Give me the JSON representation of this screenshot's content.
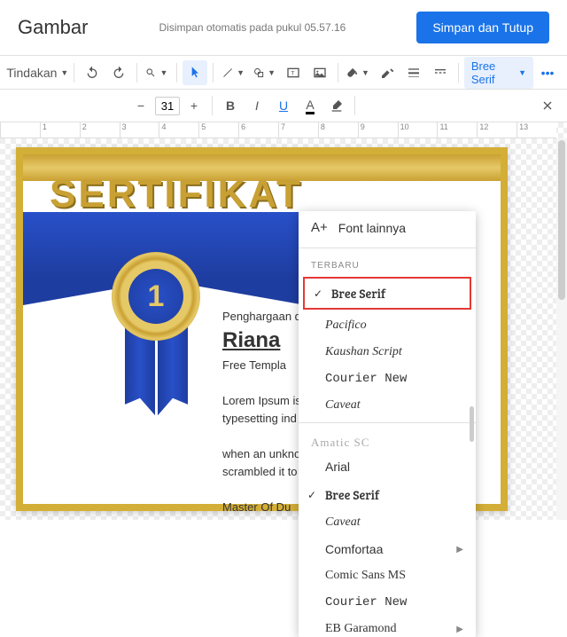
{
  "header": {
    "title": "Gambar",
    "status": "Disimpan otomatis pada pukul 05.57.16",
    "save_button": "Simpan dan Tutup"
  },
  "toolbar": {
    "actions_label": "Tindakan",
    "font_dropdown": "Bree Serif",
    "font_size": "31",
    "bold": "B",
    "italic": "I",
    "underline": "U",
    "text_color": "A"
  },
  "ruler": [
    "",
    "1",
    "2",
    "3",
    "4",
    "5",
    "6",
    "7",
    "8",
    "9",
    "10",
    "11",
    "12",
    "13"
  ],
  "doc": {
    "title": "SERTIFIKAT",
    "medal_number": "1",
    "award_label": "Penghargaan dibe",
    "name": "Riana",
    "subtitle": "Free Templa",
    "lorem1": "Lorem Ipsum is",
    "lorem2": "typesetting ind",
    "lorem3": "when an unkno",
    "lorem4": "scrambled it to",
    "master": "Master Of Du"
  },
  "font_menu": {
    "more_fonts": "Font lainnya",
    "recent_label": "TERBARU",
    "recent": [
      {
        "label": "Bree Serif",
        "family": "'Bree Serif',serif",
        "checked": true,
        "highlight": true
      },
      {
        "label": "Pacifico",
        "family": "cursive",
        "italic": true
      },
      {
        "label": "Kaushan Script",
        "family": "cursive",
        "italic": true
      },
      {
        "label": "Courier New",
        "family": "'Courier New',monospace"
      },
      {
        "label": "Caveat",
        "family": "cursive",
        "italic": true
      }
    ],
    "section2": "Amatic SC",
    "list": [
      {
        "label": "Arial",
        "family": "Arial,sans-serif"
      },
      {
        "label": "Bree Serif",
        "family": "'Bree Serif',serif",
        "checked": true
      },
      {
        "label": "Caveat",
        "family": "cursive",
        "italic": true
      },
      {
        "label": "Comfortaa",
        "family": "sans-serif",
        "arrow": true
      },
      {
        "label": "Comic Sans MS",
        "family": "'Comic Sans MS',cursive"
      },
      {
        "label": "Courier New",
        "family": "'Courier New',monospace"
      },
      {
        "label": "EB Garamond",
        "family": "Garamond,serif",
        "arrow": true
      }
    ]
  }
}
